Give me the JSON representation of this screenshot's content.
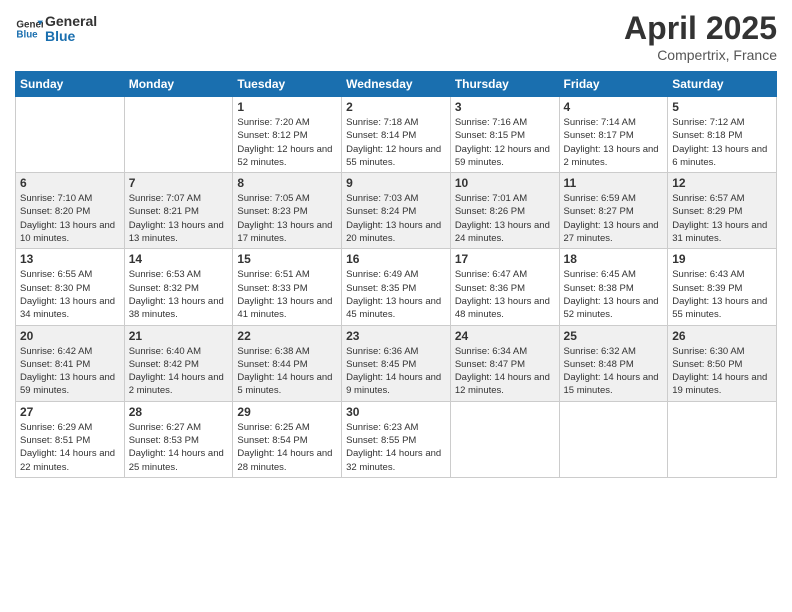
{
  "header": {
    "logo_line1": "General",
    "logo_line2": "Blue",
    "title": "April 2025",
    "location": "Compertrix, France"
  },
  "days_of_week": [
    "Sunday",
    "Monday",
    "Tuesday",
    "Wednesday",
    "Thursday",
    "Friday",
    "Saturday"
  ],
  "weeks": [
    [
      {
        "day": "",
        "info": ""
      },
      {
        "day": "",
        "info": ""
      },
      {
        "day": "1",
        "info": "Sunrise: 7:20 AM\nSunset: 8:12 PM\nDaylight: 12 hours and 52 minutes."
      },
      {
        "day": "2",
        "info": "Sunrise: 7:18 AM\nSunset: 8:14 PM\nDaylight: 12 hours and 55 minutes."
      },
      {
        "day": "3",
        "info": "Sunrise: 7:16 AM\nSunset: 8:15 PM\nDaylight: 12 hours and 59 minutes."
      },
      {
        "day": "4",
        "info": "Sunrise: 7:14 AM\nSunset: 8:17 PM\nDaylight: 13 hours and 2 minutes."
      },
      {
        "day": "5",
        "info": "Sunrise: 7:12 AM\nSunset: 8:18 PM\nDaylight: 13 hours and 6 minutes."
      }
    ],
    [
      {
        "day": "6",
        "info": "Sunrise: 7:10 AM\nSunset: 8:20 PM\nDaylight: 13 hours and 10 minutes."
      },
      {
        "day": "7",
        "info": "Sunrise: 7:07 AM\nSunset: 8:21 PM\nDaylight: 13 hours and 13 minutes."
      },
      {
        "day": "8",
        "info": "Sunrise: 7:05 AM\nSunset: 8:23 PM\nDaylight: 13 hours and 17 minutes."
      },
      {
        "day": "9",
        "info": "Sunrise: 7:03 AM\nSunset: 8:24 PM\nDaylight: 13 hours and 20 minutes."
      },
      {
        "day": "10",
        "info": "Sunrise: 7:01 AM\nSunset: 8:26 PM\nDaylight: 13 hours and 24 minutes."
      },
      {
        "day": "11",
        "info": "Sunrise: 6:59 AM\nSunset: 8:27 PM\nDaylight: 13 hours and 27 minutes."
      },
      {
        "day": "12",
        "info": "Sunrise: 6:57 AM\nSunset: 8:29 PM\nDaylight: 13 hours and 31 minutes."
      }
    ],
    [
      {
        "day": "13",
        "info": "Sunrise: 6:55 AM\nSunset: 8:30 PM\nDaylight: 13 hours and 34 minutes."
      },
      {
        "day": "14",
        "info": "Sunrise: 6:53 AM\nSunset: 8:32 PM\nDaylight: 13 hours and 38 minutes."
      },
      {
        "day": "15",
        "info": "Sunrise: 6:51 AM\nSunset: 8:33 PM\nDaylight: 13 hours and 41 minutes."
      },
      {
        "day": "16",
        "info": "Sunrise: 6:49 AM\nSunset: 8:35 PM\nDaylight: 13 hours and 45 minutes."
      },
      {
        "day": "17",
        "info": "Sunrise: 6:47 AM\nSunset: 8:36 PM\nDaylight: 13 hours and 48 minutes."
      },
      {
        "day": "18",
        "info": "Sunrise: 6:45 AM\nSunset: 8:38 PM\nDaylight: 13 hours and 52 minutes."
      },
      {
        "day": "19",
        "info": "Sunrise: 6:43 AM\nSunset: 8:39 PM\nDaylight: 13 hours and 55 minutes."
      }
    ],
    [
      {
        "day": "20",
        "info": "Sunrise: 6:42 AM\nSunset: 8:41 PM\nDaylight: 13 hours and 59 minutes."
      },
      {
        "day": "21",
        "info": "Sunrise: 6:40 AM\nSunset: 8:42 PM\nDaylight: 14 hours and 2 minutes."
      },
      {
        "day": "22",
        "info": "Sunrise: 6:38 AM\nSunset: 8:44 PM\nDaylight: 14 hours and 5 minutes."
      },
      {
        "day": "23",
        "info": "Sunrise: 6:36 AM\nSunset: 8:45 PM\nDaylight: 14 hours and 9 minutes."
      },
      {
        "day": "24",
        "info": "Sunrise: 6:34 AM\nSunset: 8:47 PM\nDaylight: 14 hours and 12 minutes."
      },
      {
        "day": "25",
        "info": "Sunrise: 6:32 AM\nSunset: 8:48 PM\nDaylight: 14 hours and 15 minutes."
      },
      {
        "day": "26",
        "info": "Sunrise: 6:30 AM\nSunset: 8:50 PM\nDaylight: 14 hours and 19 minutes."
      }
    ],
    [
      {
        "day": "27",
        "info": "Sunrise: 6:29 AM\nSunset: 8:51 PM\nDaylight: 14 hours and 22 minutes."
      },
      {
        "day": "28",
        "info": "Sunrise: 6:27 AM\nSunset: 8:53 PM\nDaylight: 14 hours and 25 minutes."
      },
      {
        "day": "29",
        "info": "Sunrise: 6:25 AM\nSunset: 8:54 PM\nDaylight: 14 hours and 28 minutes."
      },
      {
        "day": "30",
        "info": "Sunrise: 6:23 AM\nSunset: 8:55 PM\nDaylight: 14 hours and 32 minutes."
      },
      {
        "day": "",
        "info": ""
      },
      {
        "day": "",
        "info": ""
      },
      {
        "day": "",
        "info": ""
      }
    ]
  ]
}
